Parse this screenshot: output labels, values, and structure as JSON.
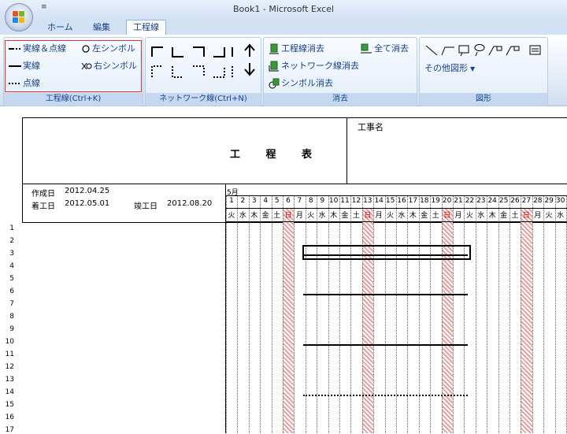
{
  "window": {
    "title": "Book1 - Microsoft Excel",
    "qat_glyph": "≡"
  },
  "tabs": [
    {
      "label": "ホーム",
      "active": false
    },
    {
      "label": "編集",
      "active": false
    },
    {
      "label": "工程線",
      "active": true
    }
  ],
  "ribbon": {
    "line_group": {
      "label": "工程線(Ctrl+K)",
      "solid_dotted": "実線＆点線",
      "solid": "実線",
      "dotted": "点線",
      "left_symbol": "左シンボル",
      "right_symbol": "右シンボル"
    },
    "network_group": {
      "label": "ネットワーク線(Ctrl+N)"
    },
    "erase_group": {
      "label": "消去",
      "erase_line": "工程線消去",
      "erase_all": "全て消去",
      "erase_network": "ネットワーク線消去",
      "erase_symbol": "シンボル消去"
    },
    "shape_group": {
      "label": "図形",
      "other_shapes": "その他図形"
    }
  },
  "sheet": {
    "title": "工 程 表",
    "project_name_label": "工事名",
    "created_label": "作成日",
    "created_date": "2012.04.25",
    "start_label": "着工日",
    "start_date": "2012.05.01",
    "end_label": "竣工日",
    "end_date": "2012.08.20",
    "month": "5月",
    "weekdays": [
      "火",
      "水",
      "木",
      "金",
      "土",
      "日",
      "月"
    ],
    "row_numbers": [
      "1",
      "2",
      "3",
      "4",
      "5",
      "6",
      "7",
      "8",
      "9",
      "10",
      "11",
      "12",
      "13",
      "14",
      "15",
      "16",
      "17"
    ],
    "sunday_shade_color": "#e8a0a0"
  }
}
